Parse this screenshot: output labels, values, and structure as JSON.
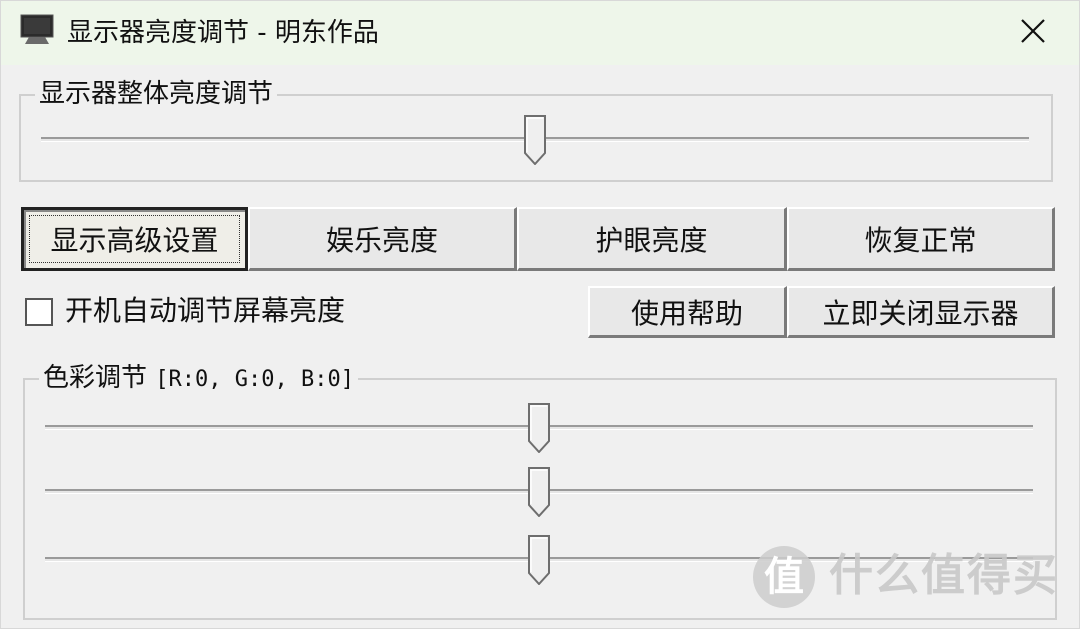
{
  "window": {
    "title": "显示器亮度调节 - 明东作品",
    "icon": "monitor-icon",
    "close_icon": "close-icon",
    "titlebar_color": "#eef6ea"
  },
  "brightness_group": {
    "title": "显示器整体亮度调节",
    "slider_value_fraction": 0.5
  },
  "buttons": {
    "advanced": "显示高级设置",
    "entertainment": "娱乐亮度",
    "eye_care": "护眼亮度",
    "restore": "恢复正常",
    "help": "使用帮助",
    "close_monitor": "立即关闭显示器"
  },
  "autostart": {
    "label": "开机自动调节屏幕亮度",
    "checked": false
  },
  "color_group": {
    "title": "色彩调节",
    "values_text": "[R:0, G:0, B:0]",
    "sliders": [
      {
        "name": "R",
        "value_fraction": 0.5
      },
      {
        "name": "G",
        "value_fraction": 0.5
      },
      {
        "name": "B",
        "value_fraction": 0.5
      }
    ]
  },
  "watermark": {
    "badge": "值",
    "text": "什么值得买"
  }
}
